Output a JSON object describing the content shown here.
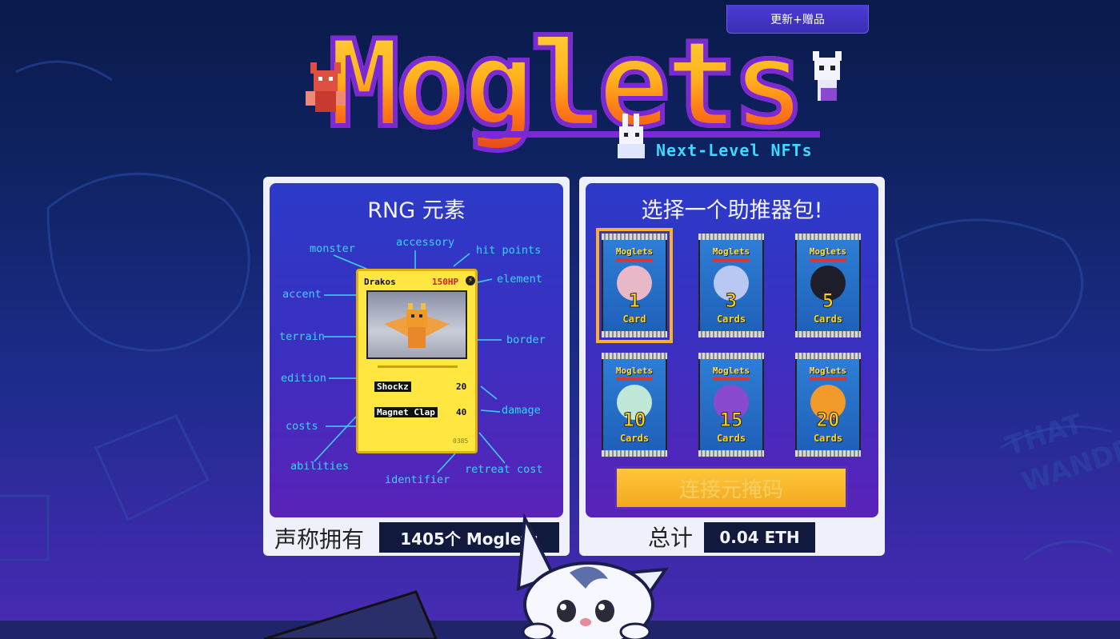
{
  "header": {
    "updates_tab": "更新+赠品",
    "logo_text": "Moglets",
    "tagline": "Next-Level NFTs"
  },
  "rng_panel": {
    "title": "RNG 元素",
    "labels": {
      "monster": "monster",
      "accessory": "accessory",
      "hit_points": "hit points",
      "element": "element",
      "accent": "accent",
      "terrain": "terrain",
      "border": "border",
      "edition": "edition",
      "damage": "damage",
      "costs": "costs",
      "abilities": "abilities",
      "identifier": "identifier",
      "retreat_cost": "retreat cost"
    },
    "card": {
      "name": "Drakos",
      "hp": "150HP",
      "ability1": "Shockz",
      "damage1": "20",
      "ability2": "Magnet Clap",
      "damage2": "40",
      "id": "0385"
    },
    "footer_label": "声称拥有",
    "footer_value": "1405个 Moglets"
  },
  "booster_panel": {
    "title": "选择一个助推器包!",
    "packs": [
      {
        "brand": "Moglets",
        "count": "1",
        "unit": "Card",
        "color": "#e8b8c8",
        "selected": true
      },
      {
        "brand": "Moglets",
        "count": "3",
        "unit": "Cards",
        "color": "#b9c8f2",
        "selected": false
      },
      {
        "brand": "Moglets",
        "count": "5",
        "unit": "Cards",
        "color": "#1e1e2a",
        "selected": false
      },
      {
        "brand": "Moglets",
        "count": "10",
        "unit": "Cards",
        "color": "#bfe8d8",
        "selected": false
      },
      {
        "brand": "Moglets",
        "count": "15",
        "unit": "Cards",
        "color": "#8a4ad0",
        "selected": false
      },
      {
        "brand": "Moglets",
        "count": "20",
        "unit": "Cards",
        "color": "#f29a2a",
        "selected": false
      }
    ],
    "connect_button": "连接元掩码",
    "footer_label": "总计",
    "footer_value": "0.04 ETH"
  },
  "colors": {
    "accent": "#3ed2ff",
    "button": "#f2a91e",
    "panel": "#3b2fc0"
  }
}
